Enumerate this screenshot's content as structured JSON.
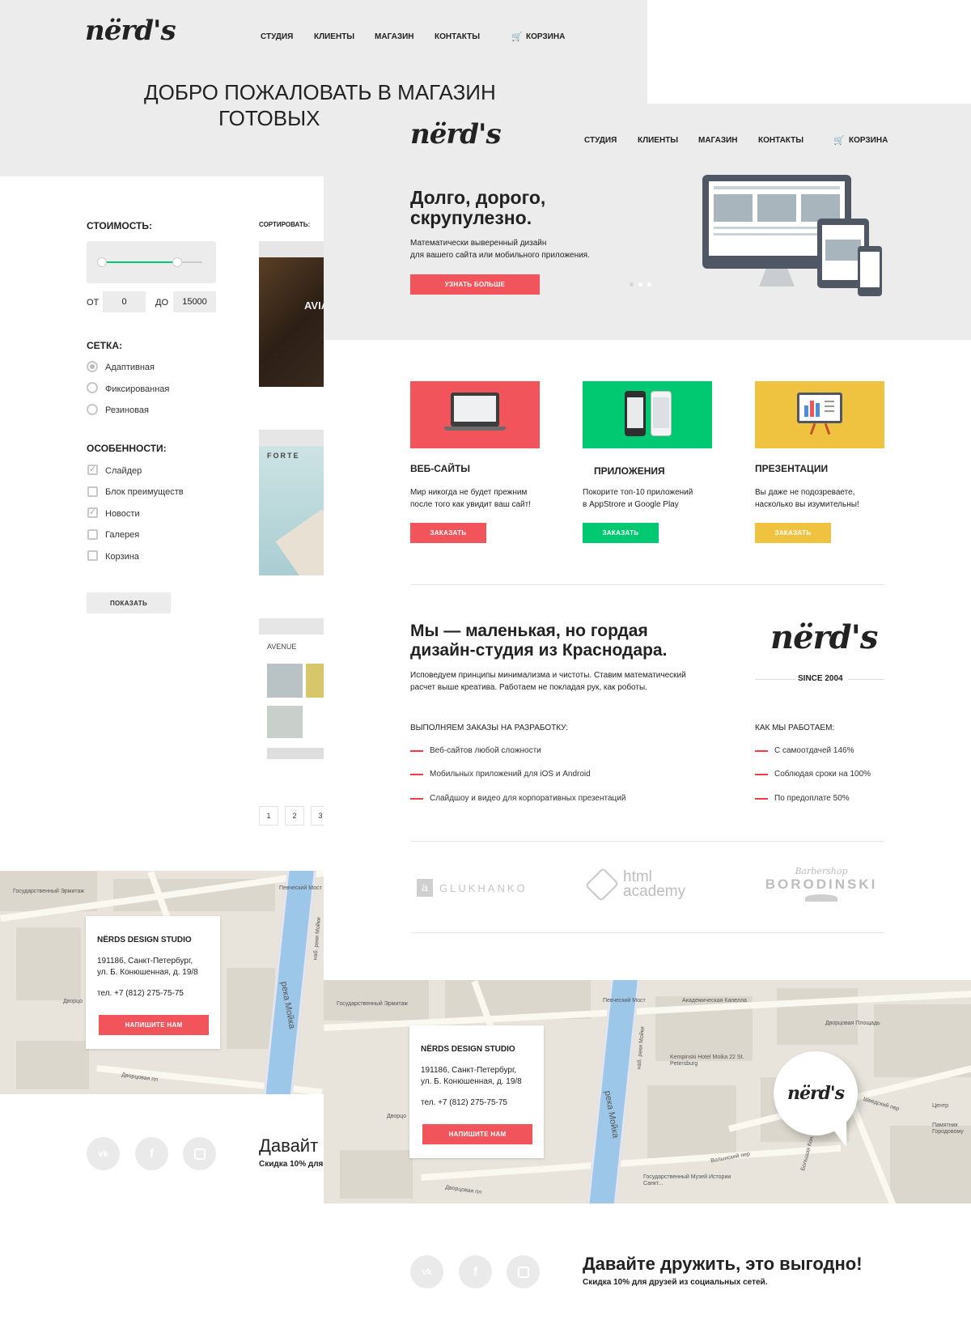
{
  "colors": {
    "accent_red": "#f2545b",
    "accent_green": "#00c972",
    "accent_yellow": "#efc340",
    "gray_bg": "#ececec"
  },
  "back": {
    "logo": "nërd's",
    "nav": [
      "СТУДИЯ",
      "КЛИЕНТЫ",
      "МАГАЗИН",
      "КОНТАКТЫ"
    ],
    "cart": "КОРЗИНА",
    "hero_title_line1": "ДОБРО ПОЖАЛОВАТЬ В МАГАЗИН",
    "hero_title_line2": "ГОТОВЫХ",
    "filter": {
      "price_label": "СТОИМОСТЬ:",
      "from_label": "ОТ",
      "from_value": "0",
      "to_label": "ДО",
      "to_value": "15000",
      "grid_label": "СЕТКА:",
      "grid_options": [
        "Адаптивная",
        "Фиксированная",
        "Резиновая"
      ],
      "grid_selected": 0,
      "features_label": "ОСОБЕННОСТИ:",
      "features": [
        {
          "label": "Слайдер",
          "checked": true
        },
        {
          "label": "Блок преимуществ",
          "checked": false
        },
        {
          "label": "Новости",
          "checked": true
        },
        {
          "label": "Галерея",
          "checked": false
        },
        {
          "label": "Корзина",
          "checked": false
        }
      ],
      "show_button": "ПОКАЗАТЬ"
    },
    "sort_label": "СОРТИРОВАТЬ:",
    "products": [
      "AVIA",
      "FORTE",
      "AVENUE"
    ],
    "pages": [
      "1",
      "2",
      "3"
    ],
    "map": {
      "labels": [
        "Государственный Эрмитаж",
        "Певческий Мост",
        "наб. реки Мойки",
        "река Мойка",
        "Дворцовая пл",
        "Дворцо"
      ],
      "card": {
        "title": "NËRDS DESIGN STUDIO",
        "address1": "191186, Санкт-Петербург,",
        "address2": "ул. Б. Конюшенная, д. 19/8",
        "phone": "тел. +7 (812) 275-75-75",
        "button": "НАПИШИТЕ НАМ"
      }
    },
    "social_title": "Давайт",
    "social_sub": "Скидка 10% для"
  },
  "front": {
    "logo": "nërd's",
    "nav": [
      "СТУДИЯ",
      "КЛИЕНТЫ",
      "МАГАЗИН",
      "КОНТАКТЫ"
    ],
    "cart": "КОРЗИНА",
    "hero": {
      "title_line1": "Долго, дорого,",
      "title_line2": "скрупулезно.",
      "text_line1": "Математически выверенный дизайн",
      "text_line2": "для вашего сайта или мобильного приложения.",
      "button": "УЗНАТЬ БОЛЬШЕ"
    },
    "services": [
      {
        "title": "ВЕБ-САЙТЫ",
        "text1": "Мир никогда не будет прежним",
        "text2": "после того как увидит ваш сайт!",
        "button": "ЗАКАЗАТЬ",
        "color": "#f2545b"
      },
      {
        "title": "ПРИЛОЖЕНИЯ",
        "text1": "Покорите топ-10 приложений",
        "text2": "в AppStrore и Google Play",
        "button": "ЗАКАЗАТЬ",
        "color": "#00c972"
      },
      {
        "title": "ПРЕЗЕНТАЦИИ",
        "text1": "Вы даже не подозреваете,",
        "text2": "насколько вы изумительны!",
        "button": "ЗАКАЗАТЬ",
        "color": "#efc340"
      }
    ],
    "about": {
      "title_line1": "Мы — маленькая, но гордая",
      "title_line2": "дизайн-студия из Краснодара.",
      "text_line1": "Исповедуем принципы минимализма и чистоты. Ставим математический",
      "text_line2": "расчет выше креатива. Работаем не покладая рук, как роботы.",
      "logo": "nërd's",
      "since": "SINCE 2004",
      "dev_title": "ВЫПОЛНЯЕМ ЗАКАЗЫ НА РАЗРАБОТКУ:",
      "dev_items": [
        "Веб-сайтов любой сложности",
        "Мобильных приложений для iOS и Android",
        "Слайдшоу и видео для корпоративных презентаций"
      ],
      "how_title": "КАК МЫ РАБОТАЕМ:",
      "how_items": [
        "С самоотдачей 146%",
        "Соблюдая сроки на 100%",
        "По предоплате 50%"
      ]
    },
    "partners": {
      "glukhanko": "GLUKHANKO",
      "html_line1": "html",
      "html_line2": "academy",
      "borodinski_top": "Barbershop",
      "borodinski": "BORODINSKI"
    },
    "map": {
      "labels": [
        "Государственный Эрмитаж",
        "Певческий Мост",
        "Академическая Капелла",
        "Дворцовая Площадь",
        "Kempinski Hotel Moika 22 St. Petersburg",
        "наб. реки Мойки",
        "река Мойка",
        "Дворцо",
        "Шведский пер",
        "Центр",
        "Памятник Городовому",
        "Государственный Музей Истории Санкт...",
        "Волынский пер",
        "Дворцовая пл",
        "Большая Кон."
      ],
      "card": {
        "title": "NËRDS DESIGN STUDIO",
        "address1": "191186, Санкт-Петербург,",
        "address2": "ул. Б. Конюшенная, д. 19/8",
        "phone": "тел. +7 (812) 275-75-75",
        "button": "НАПИШИТЕ НАМ"
      },
      "marker_logo": "nërd's"
    },
    "social": {
      "title": "Давайте дружить, это выгодно!",
      "subtitle": "Скидка 10% для друзей из социальных сетей.",
      "icons": [
        "vk-icon",
        "facebook-icon",
        "instagram-icon"
      ]
    }
  }
}
